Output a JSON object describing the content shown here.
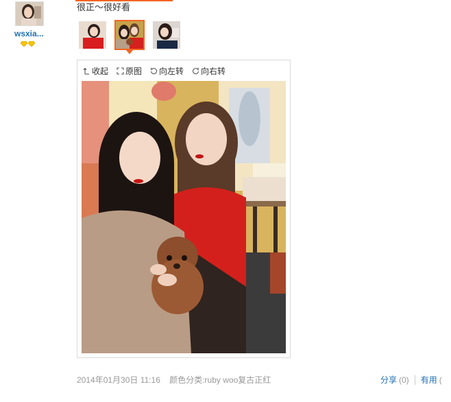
{
  "user": {
    "name": "wsxia...",
    "badge_count": 2
  },
  "comment": {
    "text": "很正～很好看"
  },
  "thumbnails": [
    {
      "name": "thumb-1",
      "selected": false
    },
    {
      "name": "thumb-2",
      "selected": true
    },
    {
      "name": "thumb-3",
      "selected": false
    }
  ],
  "viewer": {
    "tools": {
      "collapse": "收起",
      "original": "原图",
      "rotate_left": "向左转",
      "rotate_right": "向右转"
    }
  },
  "footer": {
    "date": "2014年01月30日 11:16",
    "category": "颜色分类:ruby woo复古正红"
  },
  "actions": {
    "share_label": "分享",
    "share_count": "(0)",
    "useful_label": "有用",
    "useful_count": "("
  },
  "colors": {
    "accent": "#f26522",
    "link": "#1f6fb2",
    "muted": "#999999"
  }
}
